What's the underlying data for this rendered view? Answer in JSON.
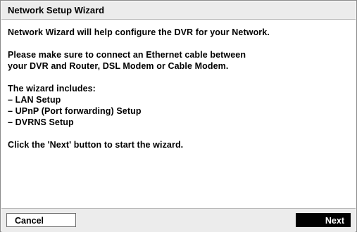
{
  "window": {
    "title": "Network Setup Wizard"
  },
  "content": {
    "intro": "Network Wizard will help configure the DVR for your Network.",
    "cable_line1": "Please make sure to connect an Ethernet cable between",
    "cable_line2": "your DVR and Router, DSL Modem or Cable Modem.",
    "includes_heading": "The wizard includes:",
    "includes_items": [
      "– LAN Setup",
      "– UPnP (Port forwarding) Setup",
      "– DVRNS Setup"
    ],
    "instruction": "Click the 'Next' button to start the wizard."
  },
  "footer": {
    "cancel_label": "Cancel",
    "next_label": "Next"
  },
  "colors": {
    "title_bar_bg": "#ececec",
    "next_button_bg": "#000000",
    "next_button_text": "#ffffff",
    "border": "#8a8a8a"
  }
}
